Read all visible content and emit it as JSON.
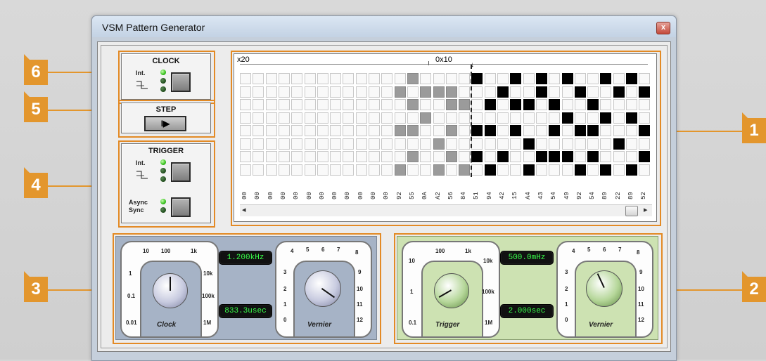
{
  "window": {
    "title": "VSM Pattern Generator",
    "close_label": "x"
  },
  "callouts": [
    "1",
    "2",
    "3",
    "4",
    "5",
    "6"
  ],
  "clock": {
    "title": "CLOCK",
    "int_label": "Int."
  },
  "step": {
    "title": "STEP",
    "button_glyph": "I▶"
  },
  "trigger": {
    "title": "TRIGGER",
    "int_label": "Int.",
    "async_label": "Async",
    "sync_label": "Sync"
  },
  "grid": {
    "marker_left": "x20",
    "marker_mid": "0x10",
    "column_values": [
      "00",
      "00",
      "00",
      "00",
      "00",
      "00",
      "00",
      "00",
      "00",
      "00",
      "00",
      "00",
      "92",
      "55",
      "0A",
      "A2",
      "56",
      "84",
      "51",
      "94",
      "42",
      "15",
      "A4",
      "43",
      "54",
      "49",
      "92",
      "54",
      "89",
      "22",
      "89",
      "52"
    ],
    "scroll_left": "◂",
    "scroll_right": "▸"
  },
  "clock_panel": {
    "scale_top": [
      "10",
      "100",
      "1k"
    ],
    "scale_left": [
      "1",
      "0.1",
      "0.01"
    ],
    "scale_right": [
      "10k",
      "100k",
      "1M"
    ],
    "name": "Clock",
    "freq_display": "1.200kHz",
    "period_display": "833.3usec",
    "vernier_scale": [
      "4",
      "5",
      "6",
      "7",
      "8",
      "3",
      "9",
      "2",
      "10",
      "1",
      "11",
      "0",
      "12"
    ],
    "vernier_name": "Vernier"
  },
  "trigger_panel": {
    "scale_top": [
      "100",
      "1k"
    ],
    "scale_left": [
      "10",
      "1",
      "0.1"
    ],
    "scale_right": [
      "10k",
      "100k",
      "1M"
    ],
    "name": "Trigger",
    "freq_display": "500.0mHz",
    "period_display": "2.000sec",
    "vernier_scale": [
      "4",
      "5",
      "6",
      "7",
      "8",
      "3",
      "9",
      "2",
      "10",
      "1",
      "11",
      "0",
      "12"
    ],
    "vernier_name": "Vernier"
  },
  "colors": {
    "accent": "#e3962d",
    "lcd_text": "#39ff4a",
    "clock_panel": "#a6b3c6",
    "trigger_panel": "#cde2b2"
  }
}
